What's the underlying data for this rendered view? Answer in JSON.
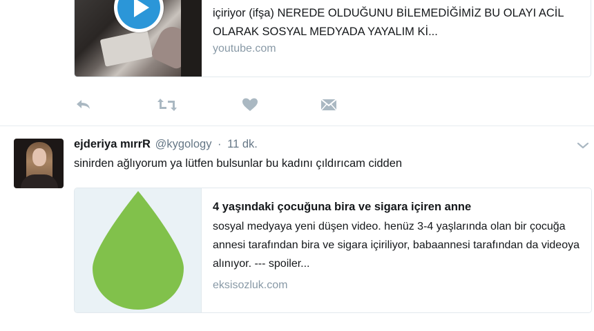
{
  "tweet1": {
    "card": {
      "description": "içiriyor (ifşa) NEREDE OLDUĞUNU BİLEMEDİĞİMİZ BU OLAYI ACİL OLARAK SOSYAL MEDYADA YAYALIM Kİ...",
      "domain": "youtube.com",
      "thumbnail_icon": "play-icon"
    },
    "actions": {
      "reply_icon": "reply-icon",
      "retweet_icon": "retweet-icon",
      "like_icon": "heart-icon",
      "dm_icon": "envelope-icon",
      "icon_color": "#aab8c2"
    }
  },
  "tweet2": {
    "author": {
      "name": "ejderiya mırrR",
      "handle": "@kygology"
    },
    "separator": "·",
    "timestamp": "11 dk.",
    "text": "sinirden ağlıyorum ya lütfen bulsunlar bu kadını çıldırıcam cidden",
    "card": {
      "title": "4 yaşındaki çocuğuna bira ve sigara içiren anne",
      "description": "sosyal medyaya yeni düşen video. henüz 3-4 yaşlarında olan bir çocuğa annesi tarafından bira ve sigara içiriliyor, babaannesi tarafından da videoya alınıyor. --- spoiler...",
      "domain": "eksisozluk.com",
      "thumbnail_icon": "drop-icon",
      "thumbnail_color": "#81c14b"
    },
    "menu_icon": "chevron-down-icon"
  },
  "colors": {
    "text": "#14171a",
    "secondary_text": "#657786",
    "domain_text": "#8899a6",
    "border": "#e1e8ed",
    "play_blue": "#2b96d8"
  }
}
